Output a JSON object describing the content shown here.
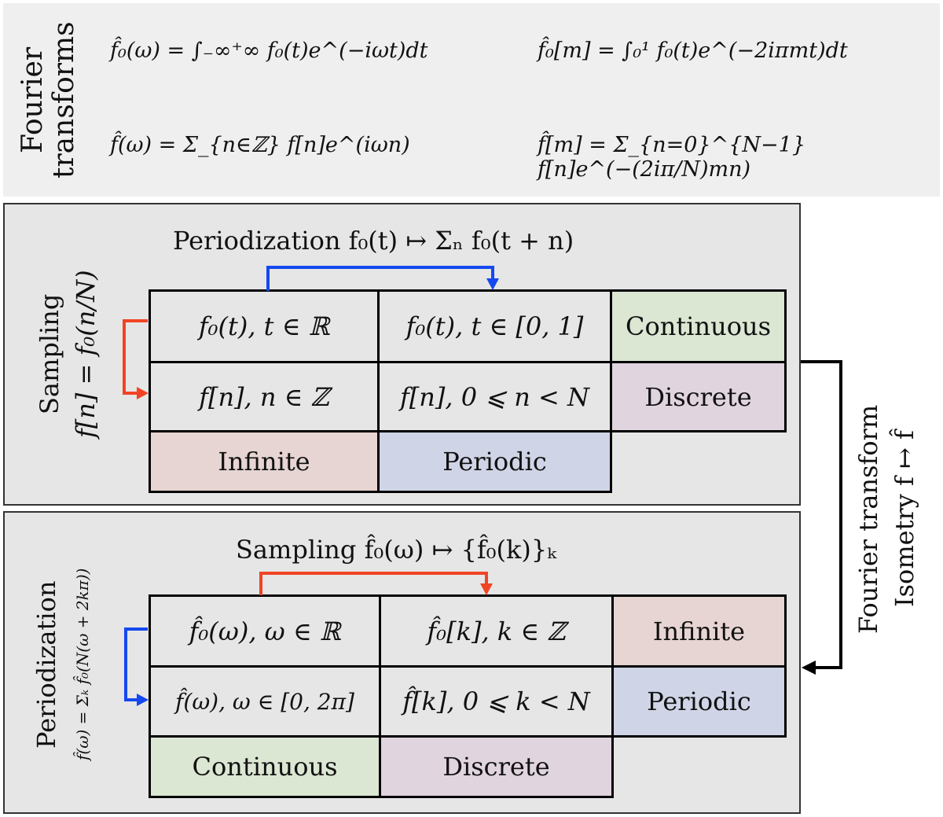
{
  "header": {
    "title_line1": "Fourier",
    "title_line2": "transforms",
    "eq_continuous": "f̂₀(ω) = ∫₋∞⁺∞ f₀(t)e^(−iωt)dt",
    "eq_periodic": "f̂₀[m] = ∫₀¹ f₀(t)e^(−2iπmt)dt",
    "eq_discrete": "f̂(ω) = Σ_{n∈ℤ} f[n]e^(iωn)",
    "eq_dft": "f̂[m] = Σ_{n=0}^{N−1} f[n]e^(−(2iπ/N)mn)"
  },
  "panel1": {
    "title": "Periodization  f₀(t) ↦ Σₙ f₀(t + n)",
    "side_title": "Sampling",
    "side_formula": "f[n] = f₀(n/N)",
    "cells": [
      [
        "f₀(t), t ∈ ℝ",
        "f₀(t), t ∈ [0, 1]",
        "Continuous"
      ],
      [
        "f[n], n ∈ ℤ",
        "f[n], 0 ⩽ n < N",
        "Discrete"
      ],
      [
        "Infinite",
        "Periodic"
      ]
    ]
  },
  "panel2": {
    "title": "Sampling  f̂₀(ω) ↦ {f̂₀(k)}ₖ",
    "side_title": "Periodization",
    "side_formula": "f̂(ω) = Σₖ f̂₀(N(ω + 2kπ))",
    "cells": [
      [
        "f̂₀(ω), ω ∈ ℝ",
        "f̂₀[k], k ∈ ℤ",
        "Infinite"
      ],
      [
        "f̂(ω), ω ∈ [0, 2π]",
        "f̂[k], 0 ⩽ k < N",
        "Periodic"
      ],
      [
        "Continuous",
        "Discrete"
      ]
    ]
  },
  "right": {
    "line1": "Fourier transform",
    "line2": "Isometry f ↦ f̂"
  },
  "colors": {
    "continuous": "#dbe6d3",
    "discrete": "#e0d4df",
    "infinite": "#e7d5d3",
    "periodic": "#cfd4e6",
    "red_arrow": "#f04424",
    "blue_arrow": "#1448f0"
  }
}
